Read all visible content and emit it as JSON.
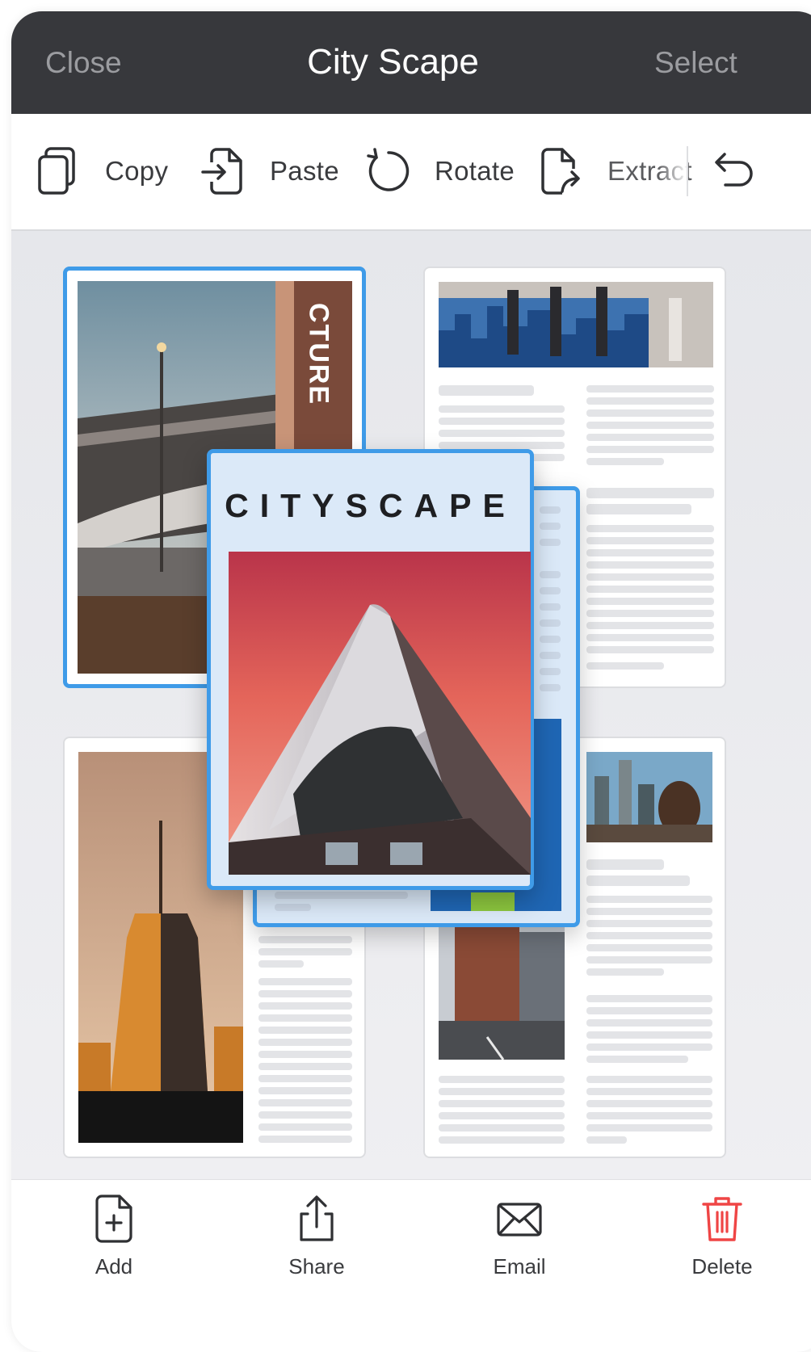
{
  "header": {
    "close_label": "Close",
    "title": "City Scape",
    "select_label": "Select"
  },
  "toolbar": {
    "copy_label": "Copy",
    "paste_label": "Paste",
    "rotate_label": "Rotate",
    "extract_label": "Extract"
  },
  "pages": {
    "cover_title": "CITYSCAPE",
    "architecture_vertical_text": "CTURE"
  },
  "bottombar": {
    "add_label": "Add",
    "share_label": "Share",
    "email_label": "Email",
    "delete_label": "Delete"
  },
  "colors": {
    "header_bg": "#37383c",
    "accent": "#3f9be8",
    "delete": "#ef4545"
  }
}
